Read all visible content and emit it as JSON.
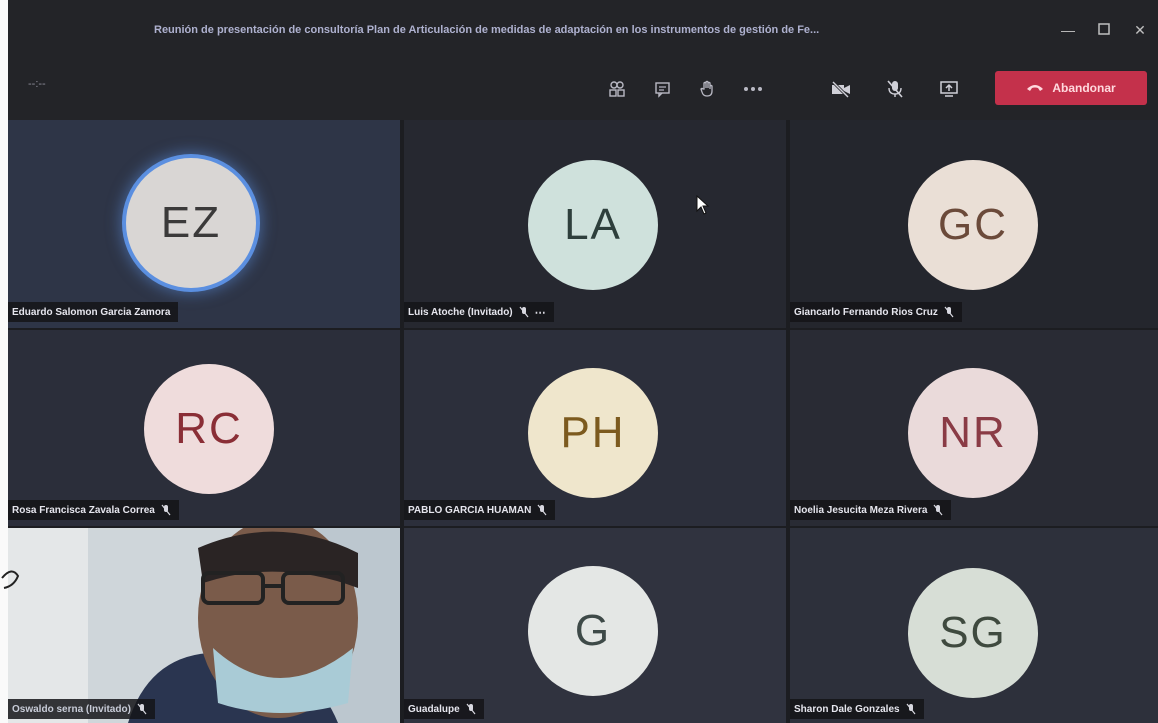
{
  "window": {
    "title": "Reunión de presentación de consultoría Plan de Articulación de medidas de adaptación en los instrumentos de gestión de Fe..."
  },
  "toolbar": {
    "timer": "--:--",
    "leave_label": "Abandonar",
    "buttons": [
      {
        "name": "participants-icon"
      },
      {
        "name": "chat-icon"
      },
      {
        "name": "raise-hand-icon"
      },
      {
        "name": "more-actions-icon"
      },
      {
        "name": "camera-off-icon"
      },
      {
        "name": "mic-off-icon"
      },
      {
        "name": "share-screen-icon"
      }
    ]
  },
  "participants": [
    {
      "initials": "EZ",
      "name": "Eduardo Salomon Garcia Zamora",
      "muted": false,
      "speaking": true,
      "more": false
    },
    {
      "initials": "LA",
      "name": "Luis Atoche (Invitado)",
      "muted": true,
      "speaking": false,
      "more": true
    },
    {
      "initials": "GC",
      "name": "Giancarlo Fernando Rios Cruz",
      "muted": true,
      "speaking": false,
      "more": false
    },
    {
      "initials": "RC",
      "name": "Rosa Francisca Zavala Correa",
      "muted": true,
      "speaking": false,
      "more": false
    },
    {
      "initials": "PH",
      "name": "PABLO GARCIA HUAMAN",
      "muted": true,
      "speaking": false,
      "more": false
    },
    {
      "initials": "NR",
      "name": "Noelia Jesucita Meza Rivera",
      "muted": true,
      "speaking": false,
      "more": false
    },
    {
      "initials": "",
      "name": "Oswaldo serna (Invitado)",
      "muted": true,
      "speaking": false,
      "more": false,
      "video": true
    },
    {
      "initials": "G",
      "name": "Guadalupe",
      "muted": true,
      "speaking": false,
      "more": false
    },
    {
      "initials": "SG",
      "name": "Sharon Dale Gonzales",
      "muted": true,
      "speaking": false,
      "more": false
    }
  ],
  "colors": {
    "background": "#1c1d21",
    "leave_button": "#c4314b",
    "speaking_ring": "#5b8fe0"
  }
}
